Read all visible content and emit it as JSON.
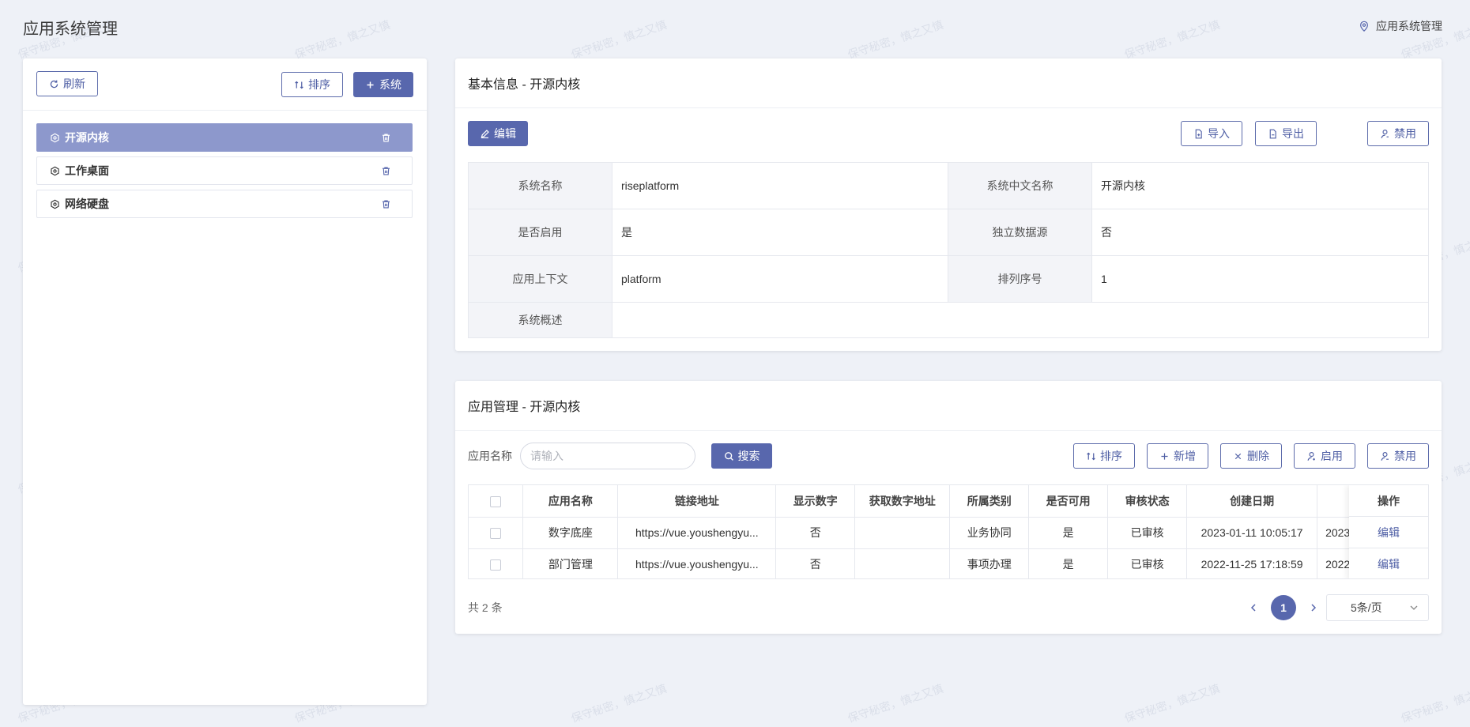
{
  "page": {
    "title": "应用系统管理",
    "breadcrumb": "应用系统管理"
  },
  "watermark": "保守秘密，慎之又慎",
  "left_panel": {
    "refresh_label": "刷新",
    "sort_label": "排序",
    "add_system_label": "系统",
    "systems": [
      {
        "label": "开源内核",
        "active": true
      },
      {
        "label": "工作桌面",
        "active": false
      },
      {
        "label": "网络硬盘",
        "active": false
      }
    ]
  },
  "info_card": {
    "title": "基本信息 - 开源内核",
    "edit_label": "编辑",
    "import_label": "导入",
    "export_label": "导出",
    "disable_label": "禁用",
    "fields": {
      "system_name_label": "系统名称",
      "system_name_value": "riseplatform",
      "cn_name_label": "系统中文名称",
      "cn_name_value": "开源内核",
      "enabled_label": "是否启用",
      "enabled_value": "是",
      "datasource_label": "独立数据源",
      "datasource_value": "否",
      "context_label": "应用上下文",
      "context_value": "platform",
      "order_label": "排列序号",
      "order_value": "1",
      "desc_label": "系统概述",
      "desc_value": ""
    }
  },
  "mgmt_card": {
    "title": "应用管理 - 开源内核",
    "search_label": "应用名称",
    "search_placeholder": "请输入",
    "search_btn": "搜索",
    "sort_label": "排序",
    "add_label": "新增",
    "delete_label": "删除",
    "enable_label": "启用",
    "disable_label": "禁用",
    "columns": [
      "应用名称",
      "链接地址",
      "显示数字",
      "获取数字地址",
      "所属类别",
      "是否可用",
      "审核状态",
      "创建日期",
      "",
      "操作"
    ],
    "rows": [
      {
        "name": "数字底座",
        "url": "https://vue.youshengyu...",
        "show_num": "否",
        "num_url": "",
        "category": "业务协同",
        "available": "是",
        "audit": "已审核",
        "created": "2023-01-11 10:05:17",
        "extra": "2023",
        "op": "编辑"
      },
      {
        "name": "部门管理",
        "url": "https://vue.youshengyu...",
        "show_num": "否",
        "num_url": "",
        "category": "事项办理",
        "available": "是",
        "audit": "已审核",
        "created": "2022-11-25 17:18:59",
        "extra": "2022",
        "op": "编辑"
      }
    ],
    "total": "共 2 条",
    "current_page": "1",
    "page_size": "5条/页"
  },
  "colors": {
    "primary": "#5867ad",
    "active_item": "#8d98cc",
    "background": "#eef1f7"
  }
}
